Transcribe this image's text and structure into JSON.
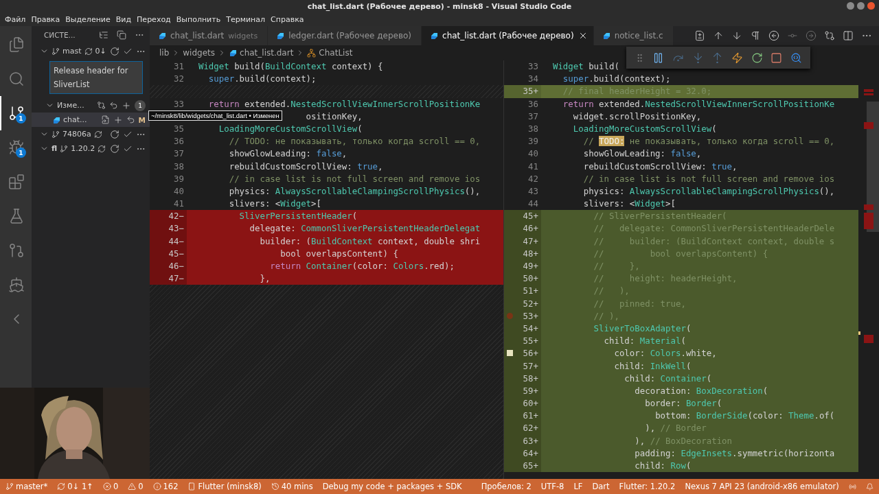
{
  "window": {
    "title": "chat_list.dart (Рабочее дерево) - minsk8 - Visual Studio Code"
  },
  "menu": [
    "Файл",
    "Правка",
    "Выделение",
    "Вид",
    "Переход",
    "Выполнить",
    "Терминал",
    "Справка"
  ],
  "activity_bar": [
    {
      "kind": "files",
      "selected": false
    },
    {
      "kind": "search",
      "selected": false
    },
    {
      "kind": "source-control",
      "selected": true,
      "badge": "1"
    },
    {
      "kind": "debug",
      "selected": false,
      "badge": "1"
    },
    {
      "kind": "extensions",
      "selected": false
    },
    {
      "kind": "testing",
      "selected": false
    },
    {
      "kind": "git-graph",
      "selected": false
    },
    {
      "kind": "docker",
      "selected": false
    },
    {
      "kind": "flutter",
      "selected": false
    }
  ],
  "sidebar": {
    "title": "СИСТЕ...",
    "repositories": [
      {
        "branch": "mast",
        "sync": "0↓",
        "expanded": true,
        "commit_message": "Release header for SliverList",
        "groups": [
          {
            "label": "Изме...",
            "count": "1",
            "expanded": true,
            "files": [
              {
                "name": "chat...",
                "status": "M",
                "selected": true
              }
            ]
          }
        ]
      },
      {
        "branch": "74806a",
        "expanded": true
      },
      {
        "repo": "fl",
        "branch": "1.20.2",
        "expanded": true
      }
    ]
  },
  "tabs": [
    {
      "label": "chat_list.dart",
      "description": "widgets",
      "selected": false
    },
    {
      "label": "ledger.dart (Рабочее дерево)",
      "selected": false
    },
    {
      "label": "chat_list.dart (Рабочее дерево)",
      "selected": true
    },
    {
      "label": "notice_list.c",
      "selected": false
    }
  ],
  "breadcrumb": [
    {
      "kind": "folder",
      "label": "lib"
    },
    {
      "kind": "folder",
      "label": "widgets"
    },
    {
      "kind": "file",
      "label": "chat_list.dart"
    },
    {
      "kind": "class",
      "label": "ChatList"
    }
  ],
  "tooltip": "~/minsk8/lib/widgets/chat_list.dart • Изменен",
  "diff": {
    "left": [
      {
        "kind": "normal",
        "number": "31",
        "tokens": [
          {
            "kind": "type",
            "text": "  Widget"
          },
          {
            "kind": "plain",
            "text": " build("
          },
          {
            "kind": "type",
            "text": "BuildContext"
          },
          {
            "kind": "plain",
            "text": " context) {"
          }
        ]
      },
      {
        "kind": "normal",
        "number": "32",
        "tokens": [
          {
            "kind": "keyword",
            "text": "    super"
          },
          {
            "kind": "plain",
            "text": ".build(context);"
          }
        ]
      },
      {
        "kind": "filler"
      },
      {
        "kind": "normal",
        "number": "33",
        "tokens": [
          {
            "kind": "control",
            "text": "    return"
          },
          {
            "kind": "plain",
            "text": " extended."
          },
          {
            "kind": "type",
            "text": "NestedScrollViewInnerScrollPositionKe"
          }
        ]
      },
      {
        "kind": "normal",
        "tokens": [
          {
            "kind": "plain",
            "text": "                       ositionKey,"
          }
        ]
      },
      {
        "kind": "normal",
        "number": "35",
        "tokens": [
          {
            "kind": "type",
            "text": "      LoadingMoreCustomScrollView"
          },
          {
            "kind": "plain",
            "text": "("
          }
        ]
      },
      {
        "kind": "normal",
        "number": "36",
        "tokens": [
          {
            "kind": "comment",
            "text": "        // TODO: не показывать, только когда scroll == 0,"
          }
        ]
      },
      {
        "kind": "normal",
        "number": "37",
        "tokens": [
          {
            "kind": "plain",
            "text": "        showGlowLeading: "
          },
          {
            "kind": "keyword",
            "text": "false"
          },
          {
            "kind": "plain",
            "text": ","
          }
        ]
      },
      {
        "kind": "normal",
        "number": "38",
        "tokens": [
          {
            "kind": "plain",
            "text": "        rebuildCustomScrollView: "
          },
          {
            "kind": "keyword",
            "text": "true"
          },
          {
            "kind": "plain",
            "text": ","
          }
        ]
      },
      {
        "kind": "normal",
        "number": "39",
        "tokens": [
          {
            "kind": "comment",
            "text": "        // in case list is not full screen and remove ios"
          }
        ]
      },
      {
        "kind": "normal",
        "number": "40",
        "tokens": [
          {
            "kind": "plain",
            "text": "        physics: "
          },
          {
            "kind": "type",
            "text": "AlwaysScrollableClampingScrollPhysics"
          },
          {
            "kind": "plain",
            "text": "(),"
          }
        ]
      },
      {
        "kind": "normal",
        "number": "41",
        "tokens": [
          {
            "kind": "plain",
            "text": "        slivers: <"
          },
          {
            "kind": "type",
            "text": "Widget"
          },
          {
            "kind": "plain",
            "text": ">["
          }
        ]
      },
      {
        "kind": "removed",
        "number": "42−",
        "tokens": [
          {
            "kind": "type",
            "text": "          SliverPersistentHeader"
          },
          {
            "kind": "plain",
            "text": "("
          }
        ]
      },
      {
        "kind": "removed",
        "number": "43−",
        "tokens": [
          {
            "kind": "plain",
            "text": "            delegate: "
          },
          {
            "kind": "type",
            "text": "CommonSliverPersistentHeaderDelegat"
          }
        ]
      },
      {
        "kind": "removed",
        "number": "44−",
        "tokens": [
          {
            "kind": "plain",
            "text": "              builder: ("
          },
          {
            "kind": "type",
            "text": "BuildContext"
          },
          {
            "kind": "plain",
            "text": " context, double shri"
          }
        ]
      },
      {
        "kind": "removed",
        "number": "45−",
        "tokens": [
          {
            "kind": "plain",
            "text": "                  bool overlapsContent) {"
          }
        ]
      },
      {
        "kind": "removed",
        "number": "46−",
        "tokens": [
          {
            "kind": "control",
            "text": "                return"
          },
          {
            "kind": "type",
            "text": " Container"
          },
          {
            "kind": "plain",
            "text": "(color: "
          },
          {
            "kind": "type",
            "text": "Colors"
          },
          {
            "kind": "plain",
            "text": ".red);"
          }
        ]
      },
      {
        "kind": "removed",
        "number": "47−",
        "tokens": [
          {
            "kind": "plain",
            "text": "              },"
          }
        ]
      }
    ],
    "right": [
      {
        "kind": "normal",
        "number": "33",
        "tokens": [
          {
            "kind": "type",
            "text": "  Widget"
          },
          {
            "kind": "plain",
            "text": " build("
          }
        ]
      },
      {
        "kind": "normal",
        "number": "34",
        "tokens": [
          {
            "kind": "keyword",
            "text": "    super"
          },
          {
            "kind": "plain",
            "text": ".build(context);"
          }
        ]
      },
      {
        "kind": "current",
        "number": "35+",
        "tokens": [
          {
            "kind": "comment",
            "text": "    // final headerHeight = 32.0;"
          }
        ]
      },
      {
        "kind": "normal",
        "number": "36",
        "tokens": [
          {
            "kind": "control",
            "text": "    return"
          },
          {
            "kind": "plain",
            "text": " extended."
          },
          {
            "kind": "type",
            "text": "NestedScrollViewInnerScrollPositionKe"
          }
        ]
      },
      {
        "kind": "normal",
        "number": "37",
        "tokens": [
          {
            "kind": "plain",
            "text": "      widget.scrollPositionKey,"
          }
        ]
      },
      {
        "kind": "normal",
        "number": "38",
        "tokens": [
          {
            "kind": "type",
            "text": "      LoadingMoreCustomScrollView"
          },
          {
            "kind": "plain",
            "text": "("
          }
        ]
      },
      {
        "kind": "normal",
        "number": "39",
        "tokens": [
          {
            "kind": "comment",
            "text": "        // "
          },
          {
            "kind": "todo",
            "text": "TODO:"
          },
          {
            "kind": "comment",
            "text": " не показывать, только когда scroll == 0,"
          }
        ]
      },
      {
        "kind": "normal",
        "number": "40",
        "tokens": [
          {
            "kind": "plain",
            "text": "        showGlowLeading: "
          },
          {
            "kind": "keyword",
            "text": "false"
          },
          {
            "kind": "plain",
            "text": ","
          }
        ]
      },
      {
        "kind": "normal",
        "number": "41",
        "tokens": [
          {
            "kind": "plain",
            "text": "        rebuildCustomScrollView: "
          },
          {
            "kind": "keyword",
            "text": "true"
          },
          {
            "kind": "plain",
            "text": ","
          }
        ]
      },
      {
        "kind": "normal",
        "number": "42",
        "tokens": [
          {
            "kind": "comment",
            "text": "        // in case list is not full screen and remove ios"
          }
        ]
      },
      {
        "kind": "normal",
        "number": "43",
        "tokens": [
          {
            "kind": "plain",
            "text": "        physics: "
          },
          {
            "kind": "type",
            "text": "AlwaysScrollableClampingScrollPhysics"
          },
          {
            "kind": "plain",
            "text": "(),"
          }
        ]
      },
      {
        "kind": "normal",
        "number": "44",
        "tokens": [
          {
            "kind": "plain",
            "text": "        slivers: <"
          },
          {
            "kind": "type",
            "text": "Widget"
          },
          {
            "kind": "plain",
            "text": ">["
          }
        ]
      },
      {
        "kind": "added",
        "number": "45+",
        "tokens": [
          {
            "kind": "comment",
            "text": "          // SliverPersistentHeader("
          }
        ]
      },
      {
        "kind": "added",
        "number": "46+",
        "tokens": [
          {
            "kind": "comment",
            "text": "          //   delegate: CommonSliverPersistentHeaderDele"
          }
        ]
      },
      {
        "kind": "added",
        "number": "47+",
        "tokens": [
          {
            "kind": "comment",
            "text": "          //     builder: (BuildContext context, double s"
          }
        ]
      },
      {
        "kind": "added",
        "number": "48+",
        "tokens": [
          {
            "kind": "comment",
            "text": "          //         bool overlapsContent) {"
          }
        ]
      },
      {
        "kind": "added",
        "number": "49+",
        "tokens": [
          {
            "kind": "comment",
            "text": "          //     },"
          }
        ]
      },
      {
        "kind": "added",
        "number": "50+",
        "tokens": [
          {
            "kind": "comment",
            "text": "          //     height: headerHeight,"
          }
        ]
      },
      {
        "kind": "added",
        "number": "51+",
        "tokens": [
          {
            "kind": "comment",
            "text": "          //   ),"
          }
        ]
      },
      {
        "kind": "added",
        "number": "52+",
        "tokens": [
          {
            "kind": "comment",
            "text": "          //   pinned: true,"
          }
        ]
      },
      {
        "kind": "added",
        "number": "53+",
        "breakpoint": true,
        "tokens": [
          {
            "kind": "comment",
            "text": "          // ),"
          }
        ]
      },
      {
        "kind": "added",
        "number": "54+",
        "tokens": [
          {
            "kind": "type",
            "text": "          SliverToBoxAdapter"
          },
          {
            "kind": "plain",
            "text": "("
          }
        ]
      },
      {
        "kind": "added",
        "number": "55+",
        "tokens": [
          {
            "kind": "plain",
            "text": "            child: "
          },
          {
            "kind": "type",
            "text": "Material"
          },
          {
            "kind": "plain",
            "text": "("
          }
        ]
      },
      {
        "kind": "added",
        "number": "56+",
        "bookmark": true,
        "tokens": [
          {
            "kind": "plain",
            "text": "              color: "
          },
          {
            "kind": "type",
            "text": "Colors"
          },
          {
            "kind": "plain",
            "text": ".white,"
          }
        ]
      },
      {
        "kind": "added",
        "number": "57+",
        "tokens": [
          {
            "kind": "plain",
            "text": "              child: "
          },
          {
            "kind": "type",
            "text": "InkWell"
          },
          {
            "kind": "plain",
            "text": "("
          }
        ]
      },
      {
        "kind": "added",
        "number": "58+",
        "tokens": [
          {
            "kind": "plain",
            "text": "                child: "
          },
          {
            "kind": "type",
            "text": "Container"
          },
          {
            "kind": "plain",
            "text": "("
          }
        ]
      },
      {
        "kind": "added",
        "number": "59+",
        "tokens": [
          {
            "kind": "plain",
            "text": "                  decoration: "
          },
          {
            "kind": "type",
            "text": "BoxDecoration"
          },
          {
            "kind": "plain",
            "text": "("
          }
        ]
      },
      {
        "kind": "added",
        "number": "60+",
        "tokens": [
          {
            "kind": "plain",
            "text": "                    border: "
          },
          {
            "kind": "type",
            "text": "Border"
          },
          {
            "kind": "plain",
            "text": "("
          }
        ]
      },
      {
        "kind": "added",
        "number": "61+",
        "tokens": [
          {
            "kind": "plain",
            "text": "                      bottom: "
          },
          {
            "kind": "type",
            "text": "BorderSide"
          },
          {
            "kind": "plain",
            "text": "(color: "
          },
          {
            "kind": "type",
            "text": "Theme"
          },
          {
            "kind": "plain",
            "text": ".of("
          }
        ]
      },
      {
        "kind": "added",
        "number": "62+",
        "tokens": [
          {
            "kind": "plain",
            "text": "                    ), "
          },
          {
            "kind": "comment",
            "text": "// Border"
          }
        ]
      },
      {
        "kind": "added",
        "number": "63+",
        "tokens": [
          {
            "kind": "plain",
            "text": "                  ), "
          },
          {
            "kind": "comment",
            "text": "// BoxDecoration"
          }
        ]
      },
      {
        "kind": "added",
        "number": "64+",
        "tokens": [
          {
            "kind": "plain",
            "text": "                  padding: "
          },
          {
            "kind": "type",
            "text": "EdgeInsets"
          },
          {
            "kind": "plain",
            "text": ".symmetric(horizonta"
          }
        ]
      },
      {
        "kind": "added",
        "number": "65+",
        "tokens": [
          {
            "kind": "plain",
            "text": "                  child: "
          },
          {
            "kind": "type",
            "text": "Row"
          },
          {
            "kind": "plain",
            "text": "("
          }
        ]
      }
    ]
  },
  "status_bar": {
    "left": [
      {
        "kind": "branch",
        "text": "master*"
      },
      {
        "kind": "sync",
        "text": "0↓ 1↑"
      },
      {
        "kind": "errors",
        "text": "0"
      },
      {
        "kind": "warnings",
        "text": "0"
      },
      {
        "kind": "infos",
        "text": "162"
      },
      {
        "kind": "device",
        "text": "Flutter (minsk8)"
      },
      {
        "kind": "timer",
        "text": "40 mins"
      },
      {
        "kind": "debug-mode",
        "text": "Debug my code + packages + SDK"
      }
    ],
    "right": [
      {
        "text": "Пробелов: 2"
      },
      {
        "text": "UTF-8"
      },
      {
        "text": "LF"
      },
      {
        "text": "Dart"
      },
      {
        "text": "Flutter: 1.20.2"
      },
      {
        "text": "Nexus 7 API 23 (android-x86 emulator)"
      }
    ]
  },
  "webcam": {
    "kind": "picture"
  }
}
